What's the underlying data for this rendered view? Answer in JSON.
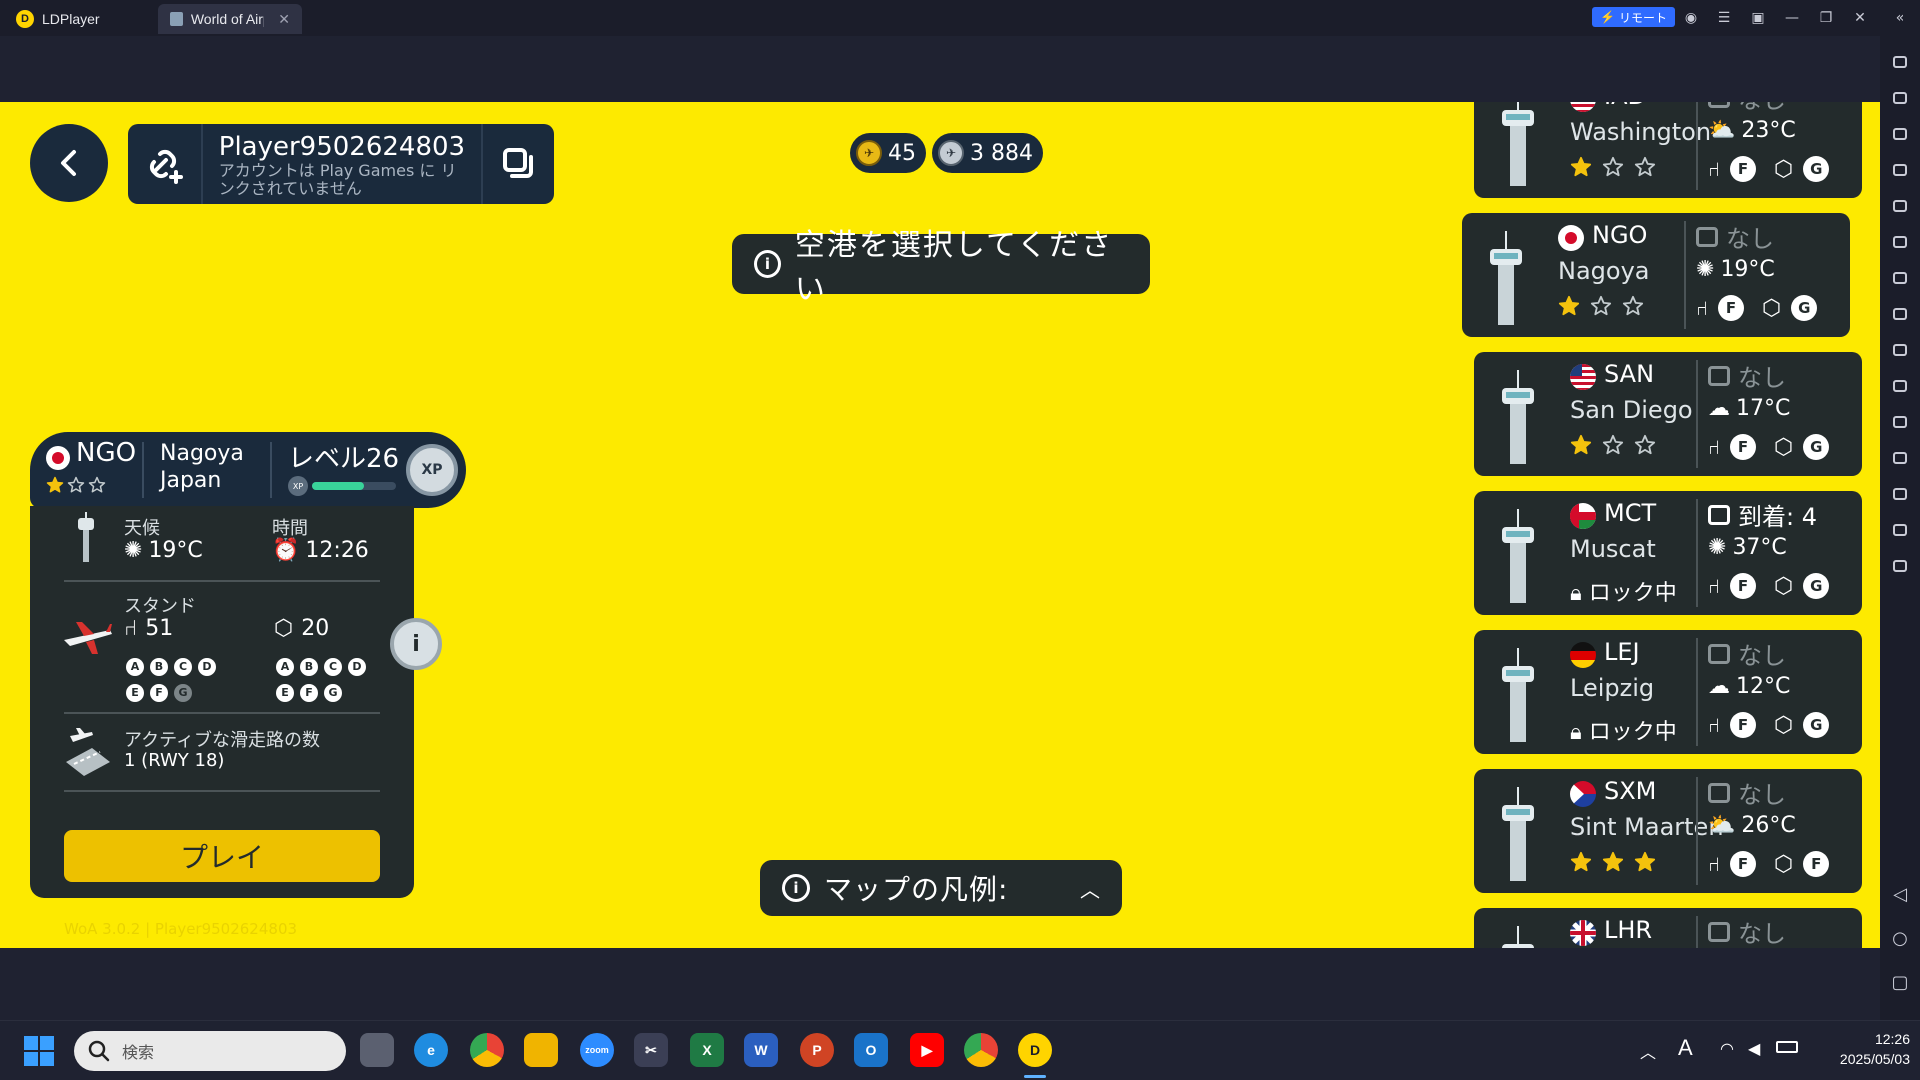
{
  "window": {
    "tabs": [
      {
        "label": "LDPlayer"
      },
      {
        "label": "World of Airp..."
      }
    ],
    "remote_label": "リモート"
  },
  "account": {
    "player_name": "Player9502624803",
    "link_status": "アカウントは Play Games に リンクされていません"
  },
  "currency": {
    "gold": "45",
    "silver": "3 884"
  },
  "banners": {
    "select_airport": "空港を選択してください",
    "map_legend": "マップの凡例:"
  },
  "selected_airport": {
    "code": "NGO",
    "city": "Nagoya",
    "country": "Japan",
    "level": "レベル26",
    "xp_badge": "XP",
    "xp_progress": 0.62,
    "stars_filled": 1,
    "stars_total": 3,
    "weather_label": "天候",
    "weather_value": "19°C",
    "time_label": "時間",
    "time_value": "12:26",
    "stands_label": "スタンド",
    "passenger_stands": "51",
    "cargo_stands": "20",
    "passenger_grades": [
      "A",
      "B",
      "C",
      "D",
      "E",
      "F",
      "G"
    ],
    "passenger_grades_active": 6,
    "cargo_grades": [
      "A",
      "B",
      "C",
      "D",
      "E",
      "F",
      "G"
    ],
    "cargo_grades_active": 7,
    "runways_label": "アクティブな滑走路の数",
    "runways_value": "1 (RWY 18)",
    "play_label": "プレイ"
  },
  "airports": [
    {
      "code": "IAD",
      "city": "Washington",
      "flag": "us",
      "arrivals": "なし",
      "weather": "23°C",
      "weather_icon": "sun-cloud",
      "stars": 1,
      "locked": false,
      "caps": [
        "F",
        "G"
      ]
    },
    {
      "code": "NGO",
      "city": "Nagoya",
      "flag": "jp",
      "arrivals": "なし",
      "weather": "19°C",
      "weather_icon": "sun",
      "stars": 1,
      "locked": false,
      "caps": [
        "F",
        "G"
      ]
    },
    {
      "code": "SAN",
      "city": "San Diego",
      "flag": "us",
      "arrivals": "なし",
      "weather": "17°C",
      "weather_icon": "cloud",
      "stars": 1,
      "locked": false,
      "caps": [
        "F",
        "G"
      ]
    },
    {
      "code": "MCT",
      "city": "Muscat",
      "flag": "om",
      "arrivals": "到着: 4",
      "weather": "37°C",
      "weather_icon": "sun",
      "stars": 0,
      "locked": true,
      "lock_label": "ロック中",
      "caps": [
        "F",
        "G"
      ]
    },
    {
      "code": "LEJ",
      "city": "Leipzig",
      "flag": "de",
      "arrivals": "なし",
      "weather": "12°C",
      "weather_icon": "cloud",
      "stars": 0,
      "locked": true,
      "lock_label": "ロック中",
      "caps": [
        "F",
        "G"
      ]
    },
    {
      "code": "SXM",
      "city": "Sint Maarten",
      "flag": "sx",
      "arrivals": "なし",
      "weather": "26°C",
      "weather_icon": "sun-cloud",
      "stars": 3,
      "locked": false,
      "caps": [
        "F",
        "F"
      ]
    },
    {
      "code": "LHR",
      "city": "",
      "flag": "gb",
      "arrivals": "なし",
      "weather": "",
      "weather_icon": "",
      "stars": 0,
      "locked": false,
      "caps": []
    }
  ],
  "version_text": "WoA 3.0.2 | Player9502624803",
  "taskbar": {
    "search_placeholder": "検索",
    "time": "12:26",
    "date": "2025/05/03",
    "ime": "A"
  },
  "colors": {
    "game_bg": "#fdea00",
    "panel_dark": "#232b2c",
    "navy": "#1a2a3c",
    "play_button": "#edc100",
    "star_gold": "#f4c20d"
  }
}
